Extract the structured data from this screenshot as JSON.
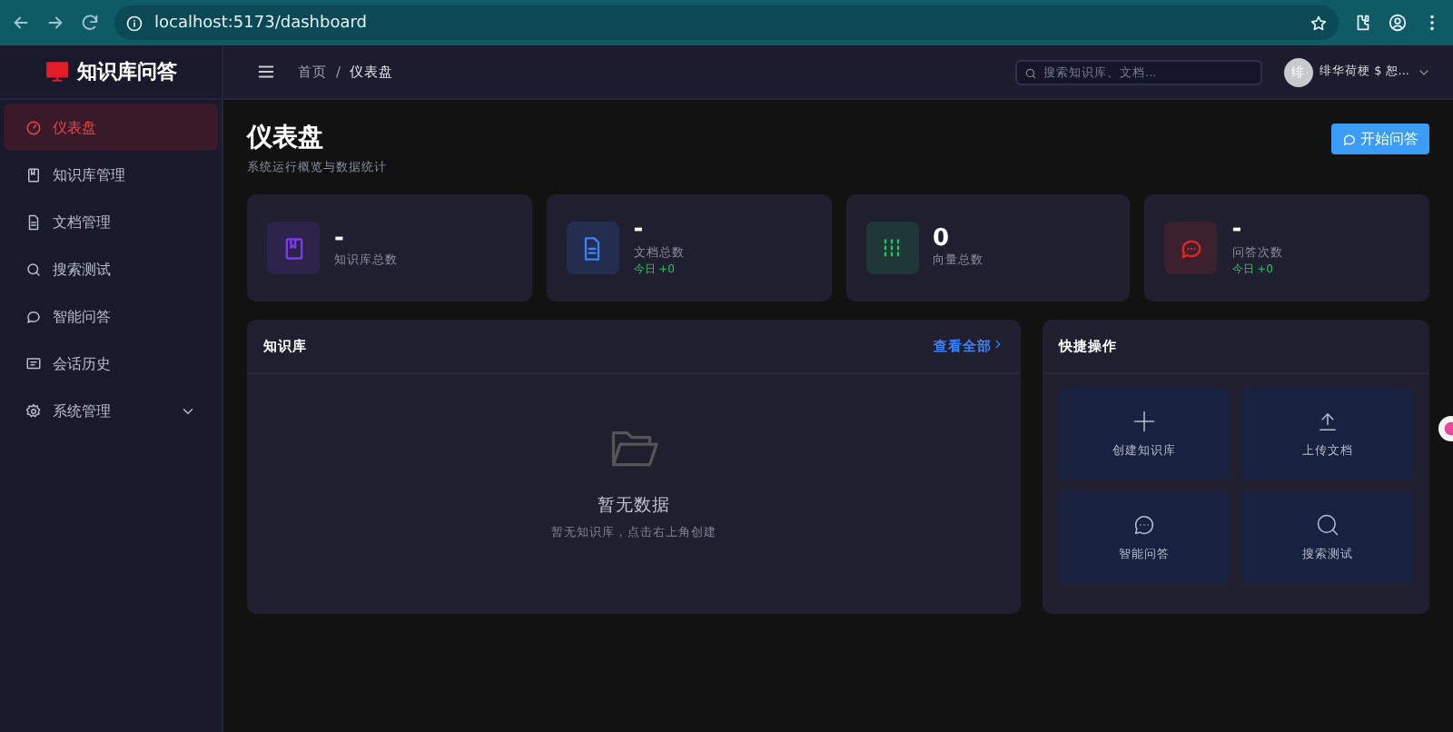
{
  "browser": {
    "url": "localhost:5173/dashboard"
  },
  "sidebar": {
    "logo": "知识库问答",
    "items": [
      {
        "label": "仪表盘",
        "selected": true,
        "kind": "link"
      },
      {
        "label": "知识库管理",
        "selected": false,
        "kind": "link"
      },
      {
        "label": "文档管理",
        "selected": false,
        "kind": "link"
      },
      {
        "label": "搜索测试",
        "selected": false,
        "kind": "link"
      },
      {
        "label": "智能问答",
        "selected": false,
        "kind": "link"
      },
      {
        "label": "会话历史",
        "selected": false,
        "kind": "link"
      },
      {
        "label": "系统管理",
        "selected": false,
        "kind": "group"
      }
    ]
  },
  "header": {
    "breadcrumb": [
      "首页",
      "仪表盘"
    ],
    "separator": "/",
    "search": {
      "placeholder": "搜索知识库、文档..."
    },
    "user": {
      "avatar": "绯",
      "name": "绯华荷梗 $ 恕..."
    }
  },
  "page": {
    "title": "仪表盘",
    "subtitle": "系统运行概览与数据统计",
    "action": "开始问答"
  },
  "stats": [
    {
      "value": "-",
      "label": "知识库总数",
      "color": "#7c3aed"
    },
    {
      "value": "-",
      "label": "文档总数",
      "trend": "今日 +0",
      "color": "#3b82f6"
    },
    {
      "value": "0",
      "label": "向量总数",
      "color": "#22c55e"
    },
    {
      "value": "-",
      "label": "问答次数",
      "trend": "今日 +0",
      "color": "#dc2626"
    }
  ],
  "knowledge_panel": {
    "title": "知识库",
    "link": "查看全部",
    "empty_title": "暂无数据",
    "empty_text": "暂无知识库，点击右上角创建"
  },
  "quick_actions": {
    "title": "快捷操作",
    "items": [
      "创建知识库",
      "上传文档",
      "智能问答",
      "搜索测试"
    ]
  }
}
